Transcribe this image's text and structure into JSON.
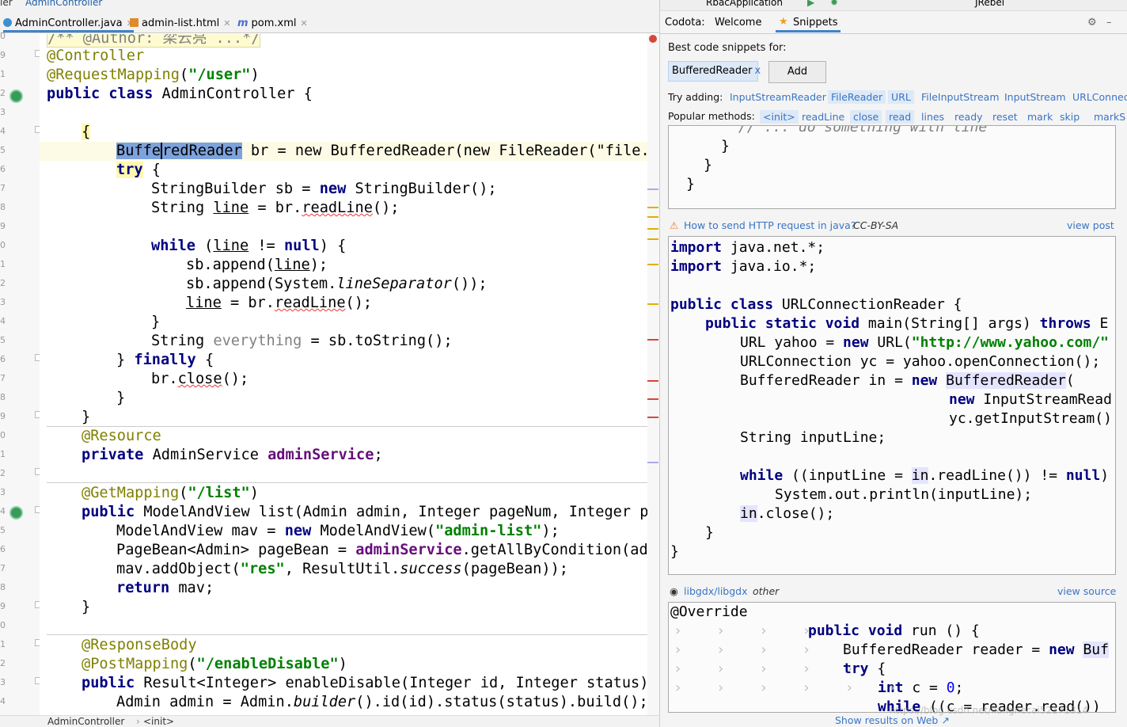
{
  "top_strip": {
    "left_fragment": "ler",
    "class_label": "AdminController",
    "run_config": "RbacApplication",
    "jrebel": "JRebel"
  },
  "tabs": [
    {
      "label": "AdminController.java",
      "active": true
    },
    {
      "label": "admin-list.html",
      "active": false
    },
    {
      "label": "pom.xml",
      "active": false
    }
  ],
  "gutter": {
    "line_digits": [
      "0",
      "9",
      "1",
      "2",
      "3",
      "4",
      "5",
      "6",
      "7",
      "8",
      "9",
      "0",
      "1",
      "2",
      "3",
      "4",
      "5",
      "6",
      "7",
      "8",
      "9",
      "0",
      "1",
      "2",
      "3",
      "4",
      "5",
      "6",
      "7",
      "8",
      "9",
      "0",
      "1",
      "2",
      "3",
      "4",
      "5",
      "6"
    ]
  },
  "editor": {
    "folded_comment": "/** @Author: 梁云亮 ...*/",
    "annotation_controller": "@Controller",
    "request_mapping": "@RequestMapping",
    "request_mapping_arg": "\"/user\"",
    "class_decl_prefix": "public class",
    "class_name": "AdminController {",
    "selected_text": "Buffe",
    "selected_rest": "redReader",
    "br_line_rest": " br = new BufferedReader(new FileReader(\"file.txt",
    "code": {
      "l_try": "try {",
      "l_sb": "StringBuilder sb = new StringBuilder();",
      "l_string_line": "String line = br.readLine();",
      "l_while": "while (line != null) {",
      "l_append1": "sb.append(line);",
      "l_append2": "sb.append(System.lineSeparator());",
      "l_readline2": "line = br.readLine();",
      "l_close_brace": "}",
      "l_everything": "String everything = sb.toString();",
      "l_finally": "} finally {",
      "l_brclose": "br.close();",
      "l_resource": "@Resource",
      "l_private": "private AdminService adminService;",
      "l_getmapping": "@GetMapping(\"/list\")",
      "l_list_sig": "public ModelAndView list(Admin admin, Integer pageNum, Integer page",
      "l_mav": "ModelAndView mav = new ModelAndView(\"admin-list\");",
      "l_pagebean": "PageBean<Admin> pageBean = adminService.getAllByCondition(admir",
      "l_addobject": "mav.addObject(\"res\", ResultUtil.success(pageBean));",
      "l_return": "return mav;",
      "l_responsebody": "@ResponseBody",
      "l_postmapping": "@PostMapping(\"/enableDisable\")",
      "l_enable_sig": "public Result<Integer> enableDisable(Integer id, Integer status) {",
      "l_builder": "Admin admin = Admin.builder().id(id).status(status).build();"
    }
  },
  "status_bar": {
    "class": "AdminController",
    "member": "<init>"
  },
  "codota": {
    "brand": "Codota:",
    "tabs": [
      "Welcome",
      "Snippets"
    ],
    "best_for": "Best code snippets for:",
    "chip": "BufferedReader",
    "chip_close": "x",
    "add_button": "Add",
    "try_adding_label": "Try adding:",
    "try_adding": [
      "InputStreamReader",
      "FileReader",
      "URL",
      "FileInputStream",
      "InputStream",
      "URLConnec"
    ],
    "popular_label": "Popular methods:",
    "popular_methods": [
      "<init>",
      "readLine",
      "close",
      "read",
      "lines",
      "ready",
      "reset",
      "mark",
      "skip",
      "markS"
    ],
    "snippet1_tail": [
      "// ... do something with line",
      "}",
      "}",
      "}"
    ],
    "post_title": "How to send HTTP request in java?",
    "post_license": "CC-BY-SA",
    "view_post": "view post",
    "snippet2": [
      "import java.net.*;",
      "import java.io.*;",
      "",
      "public class URLConnectionReader {",
      "    public static void main(String[] args) throws E",
      "        URL yahoo = new URL(\"http://www.yahoo.com/\"",
      "        URLConnection yc = yahoo.openConnection();",
      "        BufferedReader in = new BufferedReader(",
      "                                new InputStreamRead",
      "                                yc.getInputStream()",
      "        String inputLine;",
      "",
      "        while ((inputLine = in.readLine()) != null)",
      "            System.out.println(inputLine);",
      "        in.close();",
      "    }",
      "}"
    ],
    "repo": "libgdx/libgdx",
    "repo_license": "other",
    "view_source": "view source",
    "snippet3": [
      "@Override",
      "public void run () {",
      "BufferedReader reader = new Buf",
      "try {",
      "int c = 0;",
      "while ((c = reader.read())"
    ],
    "show_results": "Show results on Web ↗"
  },
  "watermark": "https://blog.csdn.net/lianghecai52171314",
  "colors": {
    "keyword": "#000080",
    "annotation": "#808000",
    "string": "#008000",
    "field": "#660e7a",
    "link": "#3a74c5",
    "selection": "#7da2dc"
  }
}
